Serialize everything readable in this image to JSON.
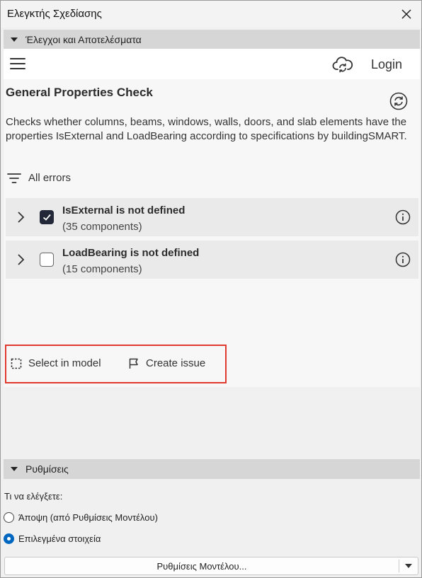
{
  "window": {
    "title": "Ελεγκτής Σχεδίασης",
    "close_icon": "close-icon"
  },
  "checks_section": {
    "label": "Έλεγχοι και Αποτελέσματα"
  },
  "topbar": {
    "login_label": "Login",
    "menu_icon": "hamburger-icon",
    "cloud_icon": "cloud-sync-icon"
  },
  "check": {
    "title": "General Properties Check",
    "description": "Checks whether columns, beams, windows, walls, doors, and slab elements have the properties IsExternal and LoadBearing according to specifications by buildingSMART.",
    "filter_label": "All errors",
    "issues": [
      {
        "name": "IsExternal is not defined",
        "count": "(35 components)",
        "checked": true
      },
      {
        "name": "LoadBearing is not defined",
        "count": "(15 components)",
        "checked": false
      }
    ]
  },
  "actions": {
    "select_label": "Select in model",
    "issue_label": "Create issue"
  },
  "settings_section": {
    "label": "Ρυθμίσεις",
    "what_to_check": "Τι να ελέγξετε:",
    "options": [
      {
        "label": "Άποψη (από Ρυθμίσεις Μοντέλου)",
        "selected": false
      },
      {
        "label": "Επιλεγμένα στοιχεία",
        "selected": true
      }
    ],
    "model_settings_button": "Ρυθμίσεις Μοντέλου..."
  },
  "colors": {
    "accent": "#0067c0",
    "highlight_border": "#e03a2e",
    "checkbox": "#222838"
  }
}
